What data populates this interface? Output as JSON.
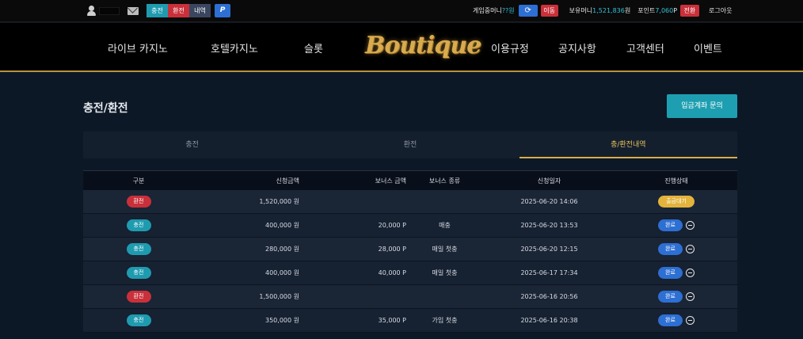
{
  "topbar": {
    "tab_charge": "충전",
    "tab_exchange": "환전",
    "tab_history": "내역",
    "point_button": "P",
    "game_money_label": "게임중머니",
    "game_money_value": "??원",
    "refresh_icon": "refresh-icon",
    "move_button": "이동",
    "balance_label": "보유머니",
    "balance_value": "1,521,836",
    "balance_unit": "원",
    "points_label": "포인트",
    "points_value": "7,060",
    "points_unit": "P",
    "convert_button": "전환",
    "logout": "로그아웃"
  },
  "nav": {
    "items": [
      "라이브 카지노",
      "호텔카지노",
      "슬롯",
      "이용규정",
      "공지사항",
      "고객센터",
      "이벤트"
    ],
    "logo": "Boutique"
  },
  "page": {
    "title": "충전/환전",
    "inquiry_button": "입금계좌 문의",
    "tabs": [
      "충전",
      "환전",
      "충/환전내역"
    ],
    "active_tab": 2
  },
  "table": {
    "headers": [
      "구분",
      "신청금액",
      "보너스 금액",
      "보너스 종류",
      "신청일자",
      "진행상태"
    ],
    "rows": [
      {
        "type": "환전",
        "amount": "1,520,000 원",
        "bonus": "",
        "bonus_type": "",
        "date": "2025-06-20 14:06",
        "status": "출금대기"
      },
      {
        "type": "충전",
        "amount": "400,000 원",
        "bonus": "20,000 P",
        "bonus_type": "매충",
        "date": "2025-06-20 13:53",
        "status": "완료"
      },
      {
        "type": "충전",
        "amount": "280,000 원",
        "bonus": "28,000 P",
        "bonus_type": "매일 첫충",
        "date": "2025-06-20 12:15",
        "status": "완료"
      },
      {
        "type": "충전",
        "amount": "400,000 원",
        "bonus": "40,000 P",
        "bonus_type": "매일 첫충",
        "date": "2025-06-17 17:34",
        "status": "완료"
      },
      {
        "type": "환전",
        "amount": "1,500,000 원",
        "bonus": "",
        "bonus_type": "",
        "date": "2025-06-16 20:56",
        "status": "완료"
      },
      {
        "type": "충전",
        "amount": "350,000 원",
        "bonus": "35,000 P",
        "bonus_type": "가입 첫충",
        "date": "2025-06-16 20:38",
        "status": "완료"
      }
    ]
  }
}
